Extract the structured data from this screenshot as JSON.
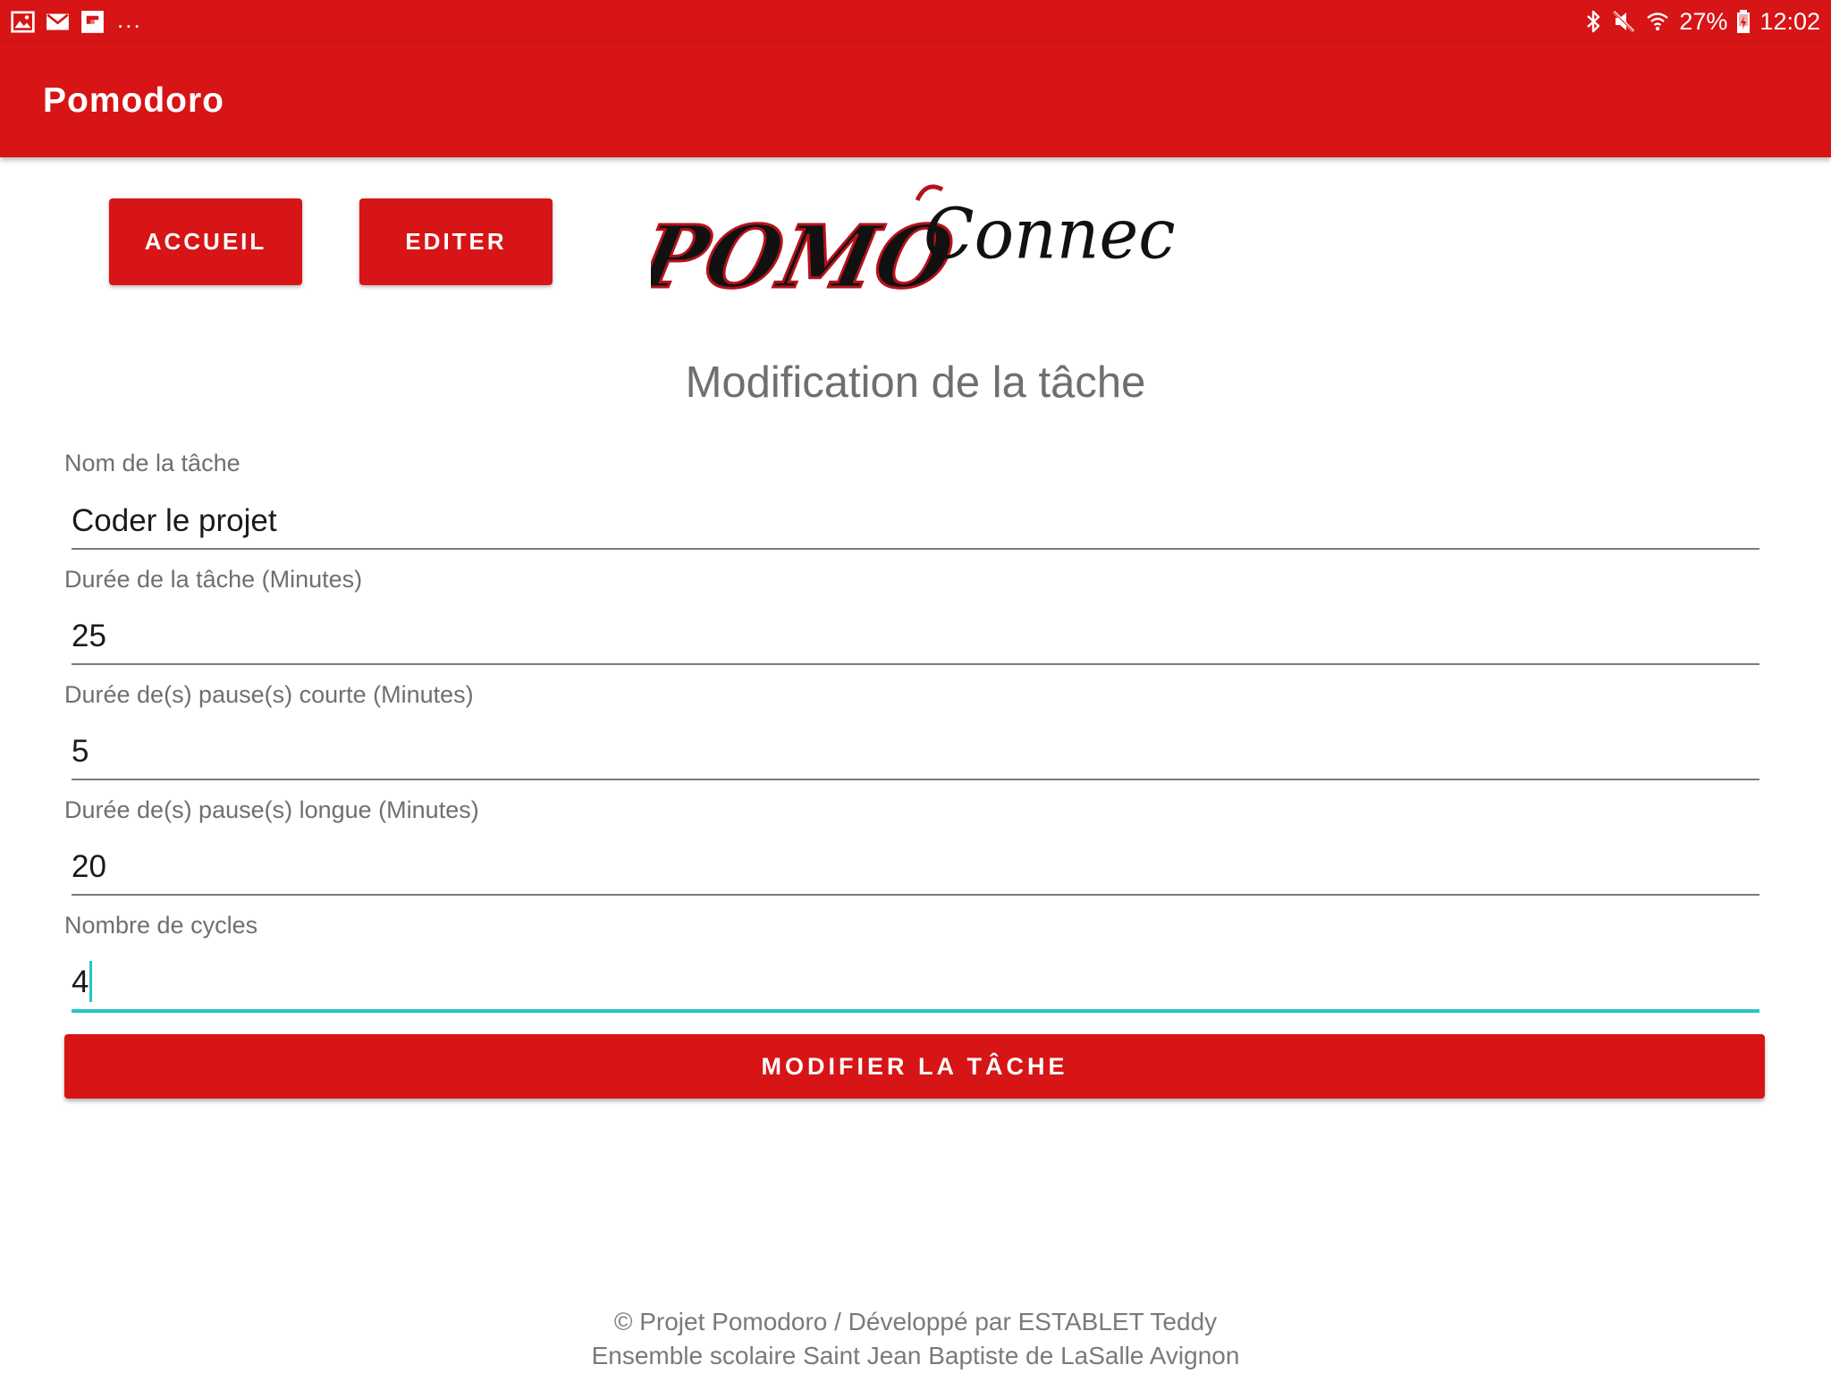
{
  "status_bar": {
    "notification_icons": [
      "image-icon",
      "mail-icon",
      "flipboard-icon"
    ],
    "more": "...",
    "battery": "27%",
    "time": "12:02",
    "system_icons": [
      "bluetooth-icon",
      "mute-icon",
      "wifi-icon",
      "battery-charging-icon"
    ]
  },
  "app_bar": {
    "title": "Pomodoro"
  },
  "nav": {
    "home_label": "ACCUEIL",
    "edit_label": "EDITER"
  },
  "logo": {
    "part1": "POMO",
    "part2": "Connect"
  },
  "page": {
    "heading": "Modification de la tâche"
  },
  "form": {
    "name_label": "Nom de la tâche",
    "name_value": "Coder le projet",
    "duration_label": "Durée de la tâche (Minutes)",
    "duration_value": "25",
    "short_break_label": "Durée de(s) pause(s) courte (Minutes)",
    "short_break_value": "5",
    "long_break_label": "Durée de(s) pause(s) longue (Minutes)",
    "long_break_value": "20",
    "cycles_label": "Nombre de cycles",
    "cycles_value": "4",
    "submit_label": "MODIFIER LA TÂCHE"
  },
  "footer": {
    "line1": "© Projet Pomodoro / Développé par ESTABLET Teddy",
    "line2": "Ensemble scolaire Saint Jean Baptiste de LaSalle Avignon"
  },
  "colors": {
    "primary": "#d71416",
    "accent": "#26c6c6",
    "label": "#6f6f6f"
  }
}
